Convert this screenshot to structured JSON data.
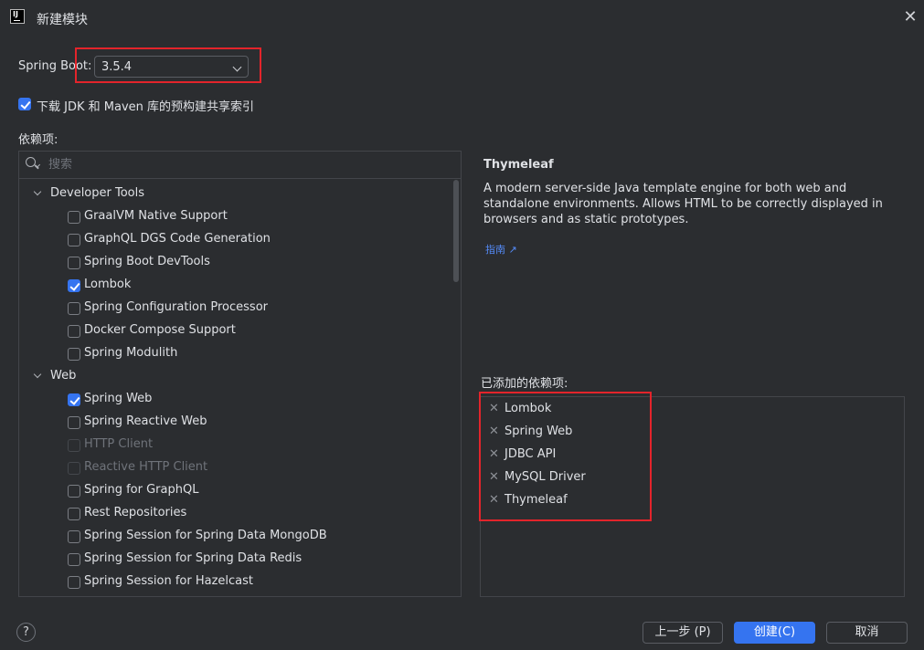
{
  "window": {
    "title": "新建模块",
    "close_icon": "close-icon"
  },
  "spring_boot": {
    "label": "Spring Boot:",
    "selected": "3.5.4"
  },
  "download_index": {
    "label": "下载 JDK 和 Maven 库的预构建共享索引",
    "checked": true
  },
  "dependencies": {
    "label": "依赖项:",
    "search_placeholder": "搜索",
    "categories": [
      {
        "name": "Developer Tools",
        "items": [
          {
            "label": "GraalVM Native Support",
            "checked": false,
            "disabled": false
          },
          {
            "label": "GraphQL DGS Code Generation",
            "checked": false,
            "disabled": false
          },
          {
            "label": "Spring Boot DevTools",
            "checked": false,
            "disabled": false
          },
          {
            "label": "Lombok",
            "checked": true,
            "disabled": false
          },
          {
            "label": "Spring Configuration Processor",
            "checked": false,
            "disabled": false
          },
          {
            "label": "Docker Compose Support",
            "checked": false,
            "disabled": false
          },
          {
            "label": "Spring Modulith",
            "checked": false,
            "disabled": false
          }
        ]
      },
      {
        "name": "Web",
        "items": [
          {
            "label": "Spring Web",
            "checked": true,
            "disabled": false
          },
          {
            "label": "Spring Reactive Web",
            "checked": false,
            "disabled": false
          },
          {
            "label": "HTTP Client",
            "checked": false,
            "disabled": true
          },
          {
            "label": "Reactive HTTP Client",
            "checked": false,
            "disabled": true
          },
          {
            "label": "Spring for GraphQL",
            "checked": false,
            "disabled": false
          },
          {
            "label": "Rest Repositories",
            "checked": false,
            "disabled": false
          },
          {
            "label": "Spring Session for Spring Data MongoDB",
            "checked": false,
            "disabled": false
          },
          {
            "label": "Spring Session for Spring Data Redis",
            "checked": false,
            "disabled": false
          },
          {
            "label": "Spring Session for Hazelcast",
            "checked": false,
            "disabled": false
          }
        ]
      }
    ]
  },
  "detail": {
    "title": "Thymeleaf",
    "description": "A modern server-side Java template engine for both web and standalone environments. Allows HTML to be correctly displayed in browsers and as static prototypes.",
    "guide_link": "指南 ↗"
  },
  "added": {
    "label": "已添加的依赖项:",
    "items": [
      "Lombok",
      "Spring Web",
      "JDBC API",
      "MySQL Driver",
      "Thymeleaf"
    ]
  },
  "buttons": {
    "help": "?",
    "previous": "上一步 (P)",
    "create": "创建(C)",
    "cancel": "取消"
  },
  "colors": {
    "background": "#2b2d30",
    "accent": "#3574f0",
    "highlight_box": "#e3242b",
    "link": "#548af7"
  }
}
